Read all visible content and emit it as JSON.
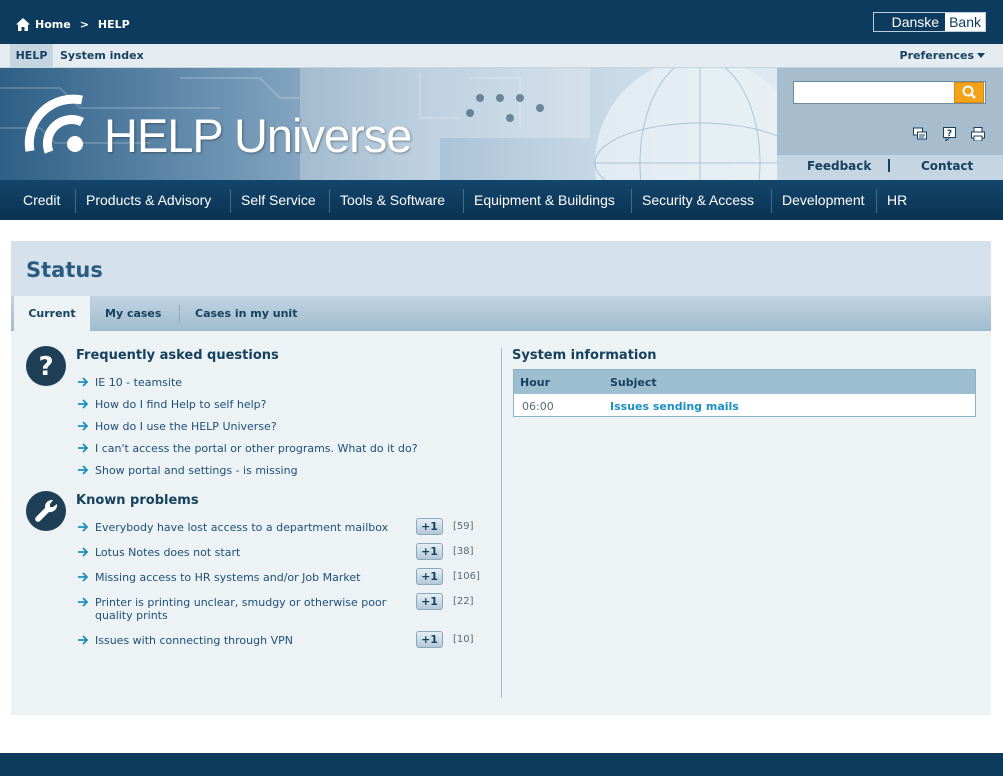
{
  "topbar": {
    "home_label": "Home",
    "separator": ">",
    "current_label": "HELP",
    "brand_left": "Danske",
    "brand_right": "Bank"
  },
  "subbar": {
    "tabs": [
      "HELP",
      "System index"
    ],
    "preferences_label": "Preferences"
  },
  "banner": {
    "title": "HELP Universe"
  },
  "search": {
    "value": "",
    "placeholder": ""
  },
  "tools": [
    "chat-icon",
    "help-icon",
    "print-icon"
  ],
  "links": {
    "feedback": "Feedback",
    "contact": "Contact"
  },
  "nav": {
    "items": [
      "Credit",
      "Products & Advisory",
      "Self Service",
      "Tools & Software",
      "Equipment & Buildings",
      "Security & Access",
      "Development",
      "HR"
    ]
  },
  "status": {
    "title": "Status",
    "tabs": [
      "Current",
      "My cases",
      "Cases in my unit"
    ],
    "active_tab": "Current"
  },
  "faq": {
    "title": "Frequently asked questions",
    "items": [
      "IE 10 - teamsite",
      "How do I find Help to self help?",
      "How do I use the HELP Universe?",
      "I can't access the portal or other programs. What do it do?",
      "Show portal and settings - is missing"
    ]
  },
  "known_problems": {
    "title": "Known problems",
    "vote_label": "+1",
    "items": [
      {
        "text": "Everybody have lost access to a department mailbox",
        "count": "[59]"
      },
      {
        "text": "Lotus Notes does not start",
        "count": "[38]"
      },
      {
        "text": "Missing access to HR systems and/or Job Market",
        "count": "[106]"
      },
      {
        "text": "Printer is printing unclear, smudgy or otherwise poor quality prints",
        "count": "[22]"
      },
      {
        "text": "Issues with connecting through VPN",
        "count": "[10]"
      }
    ]
  },
  "system_info": {
    "title": "System information",
    "columns": [
      "Hour",
      "Subject"
    ],
    "rows": [
      {
        "hour": "06:00",
        "subject": "Issues sending mails"
      }
    ]
  },
  "colors": {
    "navy": "#0d3b5e",
    "accent_orange": "#f2a21b",
    "link_blue": "#1e4f7a",
    "highlight_link": "#1a8fc4"
  }
}
